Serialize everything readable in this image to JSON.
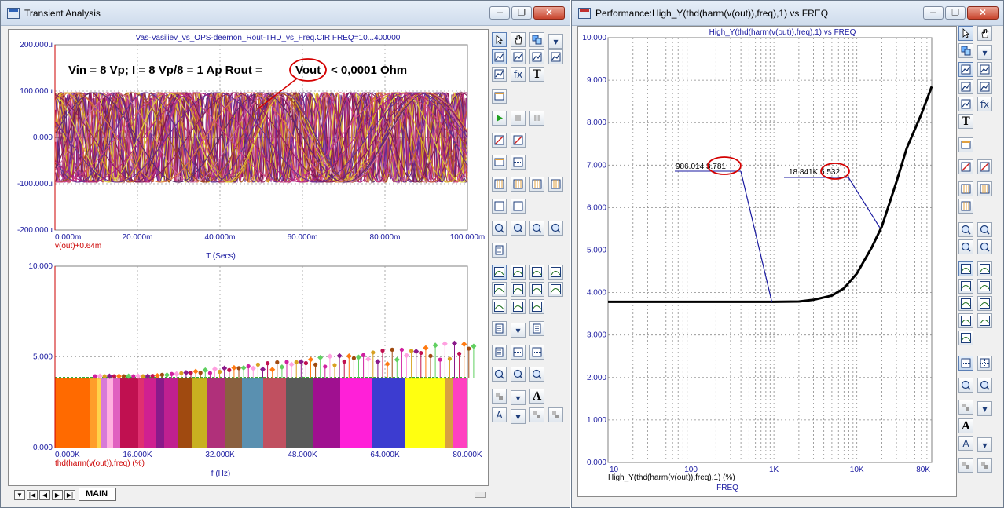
{
  "left_window": {
    "title": "Transient Analysis",
    "circuit_title": "Vas-Vasiliev_vs_OPS-deemon_Rout-THD_vs_Freq.CIR FREQ=10...400000",
    "annotation": "Vin = 8 Vp; I = 8 Vp/8 = 1 Ap      Rout =",
    "annotation_vout": "Vout",
    "annotation_tail": "< 0,0001 Ohm",
    "top_plot": {
      "y_ticks": [
        "200.000u",
        "100.000u",
        "0.000",
        "-100.000u",
        "-200.000u"
      ],
      "x_ticks": [
        "0.000m",
        "20.000m",
        "40.000m",
        "60.000m",
        "80.000m",
        "100.000m"
      ],
      "trace_label": "v(out)+0.64m",
      "x_title": "T (Secs)"
    },
    "bottom_plot": {
      "y_ticks": [
        "10.000",
        "5.000",
        "0.000"
      ],
      "x_ticks": [
        "0.000K",
        "16.000K",
        "32.000K",
        "48.000K",
        "64.000K",
        "80.000K"
      ],
      "trace_label": "thd(harm(v(out)),freq) (%)",
      "x_title": "f (Hz)"
    },
    "tab_label": "MAIN",
    "colors": {
      "axis_text": "#1a1aa0",
      "trace_label": "#cc0000",
      "annotation_ring": "#d40000"
    }
  },
  "right_window": {
    "title": "Performance:High_Y(thd(harm(v(out)),freq),1) vs FREQ",
    "plot_title": "High_Y(thd(harm(v(out)),freq),1) vs FREQ",
    "y_ticks": [
      "10.000",
      "9.000",
      "8.000",
      "7.000",
      "6.000",
      "5.000",
      "4.000",
      "3.000",
      "2.000",
      "1.000",
      "0.000"
    ],
    "x_ticks": [
      "10",
      "100",
      "1K",
      "10K",
      "80K"
    ],
    "y_label": "High_Y(thd(harm(v(out)),freq),1) (%)",
    "x_title": "FREQ",
    "marker_1": "986.014,3.781",
    "marker_2": "18.841K,5.532"
  },
  "chart_data": [
    {
      "type": "line",
      "title": "",
      "xlabel": "T (Secs)",
      "ylabel": "",
      "series": [
        {
          "name": "v(out)+0.64m",
          "note_shape": "family of sinusoids, amplitude ~ 90u"
        }
      ],
      "xlim": [
        0,
        0.1
      ],
      "ylim": [
        -0.0002,
        0.0002
      ],
      "grid": true
    },
    {
      "type": "bar",
      "title": "",
      "xlabel": "f (Hz)",
      "ylabel": "",
      "series": [
        {
          "name": "thd(harm(v(out)),freq) (%)"
        }
      ],
      "xlim": [
        0,
        80000
      ],
      "ylim": [
        0,
        10
      ],
      "base_value": 3.85,
      "grid": true
    },
    {
      "type": "line",
      "title": "High_Y(thd(harm(v(out)),freq),1) vs FREQ",
      "xlabel": "FREQ",
      "ylabel": "High_Y(thd(harm(v(out)),freq),1) (%)",
      "x_scale": "log",
      "xlim": [
        10,
        80000
      ],
      "ylim": [
        0,
        10
      ],
      "grid": true,
      "series": [
        {
          "name": "High_Y(thd(harm(v(out)),freq),1)",
          "x": [
            10,
            100,
            500,
            1000,
            2000,
            3000,
            5000,
            7000,
            10000,
            15000,
            20000,
            30000,
            40000,
            60000,
            80000
          ],
          "y": [
            3.781,
            3.781,
            3.781,
            3.781,
            3.79,
            3.83,
            3.93,
            4.1,
            4.45,
            5.05,
            5.55,
            6.6,
            7.4,
            8.2,
            8.85
          ]
        }
      ],
      "markers": [
        {
          "x": 986.014,
          "y": 3.781
        },
        {
          "x": 18841,
          "y": 5.532
        }
      ]
    }
  ]
}
